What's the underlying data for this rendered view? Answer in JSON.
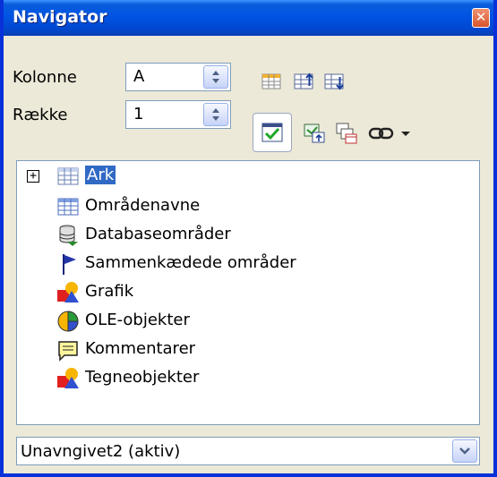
{
  "window": {
    "title": "Navigator",
    "close_glyph": "✕"
  },
  "fields": {
    "column_label": "Kolonne",
    "column_value": "A",
    "row_label": "Række",
    "row_value": "1"
  },
  "toolbar": {
    "icons": [
      "content-view-icon",
      "start-icon",
      "end-icon",
      "toggle-icon",
      "drag-mode-icon",
      "scenarios-icon",
      "link-icon",
      "dropdown-arrow-icon"
    ]
  },
  "tree": {
    "items": [
      {
        "label": "Ark",
        "icon": "sheet-icon",
        "selected": true,
        "expandable": true
      },
      {
        "label": "Områdenavne",
        "icon": "range-names-icon"
      },
      {
        "label": "Databaseområder",
        "icon": "database-icon"
      },
      {
        "label": "Sammenkædede områder",
        "icon": "flag-icon"
      },
      {
        "label": "Grafik",
        "icon": "graphics-icon"
      },
      {
        "label": "OLE-objekter",
        "icon": "ole-icon"
      },
      {
        "label": "Kommentarer",
        "icon": "comment-icon"
      },
      {
        "label": "Tegneobjekter",
        "icon": "drawing-icon"
      }
    ]
  },
  "document_select": {
    "value": "Unavngivet2 (aktiv)"
  }
}
